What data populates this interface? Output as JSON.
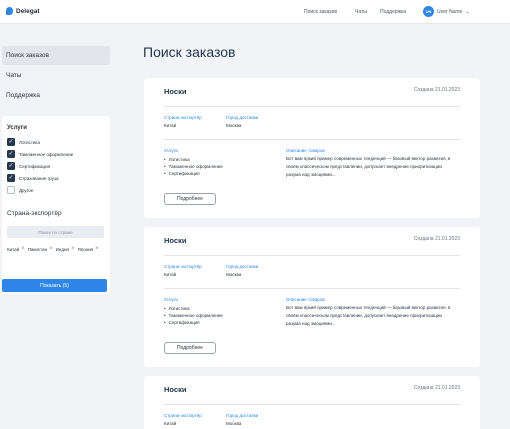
{
  "brand": {
    "name": "Delegat",
    "accent": "#2f86e8",
    "dark": "#23374d"
  },
  "topnav": [
    "Поиск заказов",
    "Чаты",
    "Поддержка"
  ],
  "user": {
    "initials": "UN",
    "name": "User Name",
    "menu_icon": "chevron-down-icon"
  },
  "sidebar": {
    "items": [
      {
        "label": "Поиск заказов",
        "active": true
      },
      {
        "label": "Чаты",
        "active": false
      },
      {
        "label": "Поддержка",
        "active": false
      }
    ]
  },
  "filters": {
    "services_title": "Услуги",
    "services": [
      {
        "label": "Логистика",
        "checked": true
      },
      {
        "label": "Таможенное оформление",
        "checked": true
      },
      {
        "label": "Сертификация",
        "checked": true
      },
      {
        "label": "Страхование груза",
        "checked": true
      },
      {
        "label": "Другое",
        "checked": false
      }
    ],
    "country_title": "Страна-экспортёр",
    "country_placeholder": "Поиск по стране",
    "selected_countries": [
      "Китай",
      "Пакистан",
      "Индия",
      "Япония"
    ],
    "show_button": "Показать (5)"
  },
  "main": {
    "title": "Поиск заказов",
    "orders": [
      {
        "title": "Носки",
        "date": "Создана 21.01.2023",
        "country_label": "Страна-экспортёр",
        "country": "Китай",
        "city_label": "Город доставки",
        "city": "Москва",
        "services_label": "Услуги",
        "services": [
          "Логистика",
          "Таможенное оформление",
          "Сертификация"
        ],
        "desc_label": "Описание товаров",
        "desc": "Вот вам яркий пример современных тенденций — базовый вектор развития, в своём классическом представлении, допускает внедрение приоритизации разума над эмоциями...",
        "more": "Подробнее"
      },
      {
        "title": "Носки",
        "date": "Создана 21.01.2023",
        "country_label": "Страна-экспортёр",
        "country": "Китай",
        "city_label": "Город доставки",
        "city": "Москва",
        "services_label": "Услуги",
        "services": [
          "Логистика",
          "Таможенное оформление",
          "Сертификация"
        ],
        "desc_label": "Описание товаров",
        "desc": "Вот вам яркий пример современных тенденций — базовый вектор развития, в своём классическом представлении, допускает внедрение приоритизации разума над эмоциями...",
        "more": "Подробнее"
      },
      {
        "title": "Носки",
        "date": "Создана 21.01.2023",
        "country_label": "Страна-экспортёр",
        "country": "Китай",
        "city_label": "Город доставки",
        "city": "Москва"
      }
    ]
  }
}
